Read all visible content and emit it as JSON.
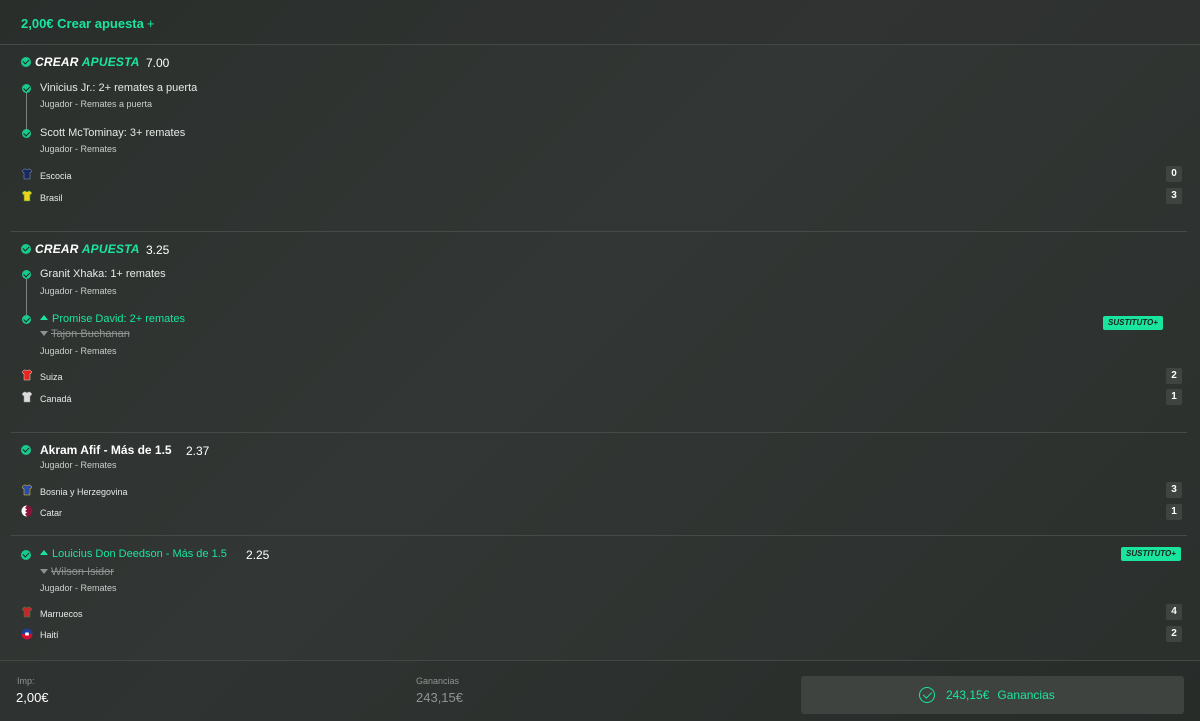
{
  "header": {
    "stake_and_title": "2,00€ Crear apuesta",
    "plus": "+"
  },
  "bets": [
    {
      "title_word1": "CREAR",
      "title_word2": "APUESTA",
      "odds": "7.00",
      "legs": [
        {
          "name": "Vinicius Jr.: 2+ remates a puerta",
          "market": "Jugador - Remates a puerta"
        },
        {
          "name": "Scott McTominay: 3+ remates",
          "market": "Jugador - Remates"
        }
      ],
      "teams": [
        {
          "name": "Escocia",
          "score": "0",
          "color": "#1a2a5a"
        },
        {
          "name": "Brasil",
          "score": "3",
          "color": "#f2d11b"
        }
      ]
    },
    {
      "title_word1": "CREAR",
      "title_word2": "APUESTA",
      "odds": "3.25",
      "legs": [
        {
          "name": "Granit Xhaka: 1+ remates",
          "market": "Jugador - Remates"
        },
        {
          "name": "Promise David: 2+ remates",
          "replaced": "Tajon Buchanan",
          "market": "Jugador - Remates",
          "badge": "SUSTITUTO+"
        }
      ],
      "teams": [
        {
          "name": "Suiza",
          "score": "2",
          "color": "#e3261f"
        },
        {
          "name": "Canadá",
          "score": "1",
          "color": "#dcdcdc"
        }
      ]
    },
    {
      "name": "Akram Afif - Más de 1.5",
      "odds": "2.37",
      "market": "Jugador - Remates",
      "teams": [
        {
          "name": "Bosnia y Herzegovina",
          "score": "3",
          "color": "#2c4aa8"
        },
        {
          "name": "Catar",
          "score": "1",
          "color": "#8a1538"
        }
      ]
    },
    {
      "name": "Louicius Don Deedson - Más de 1.5",
      "odds": "2.25",
      "replaced": "Wilson Isidor",
      "market": "Jugador - Remates",
      "badge": "SUSTITUTO+",
      "teams": [
        {
          "name": "Marruecos",
          "score": "4",
          "color": "#c1272d"
        },
        {
          "name": "Haití",
          "score": "2",
          "color": "#1d3f9a"
        }
      ]
    }
  ],
  "footer": {
    "stake_label": "Imp:",
    "stake_value": "2,00€",
    "winnings_label": "Ganancias",
    "winnings_value": "243,15€",
    "cta_amount": "243,15€",
    "cta_label": "Ganancias"
  },
  "colors": {
    "accent": "#19e59f",
    "background": "#2f3330"
  },
  "icons": {
    "check": "check-circle-icon",
    "up": "arrow-up-icon",
    "down": "arrow-down-icon",
    "shirt": "team-shirt-icon"
  }
}
